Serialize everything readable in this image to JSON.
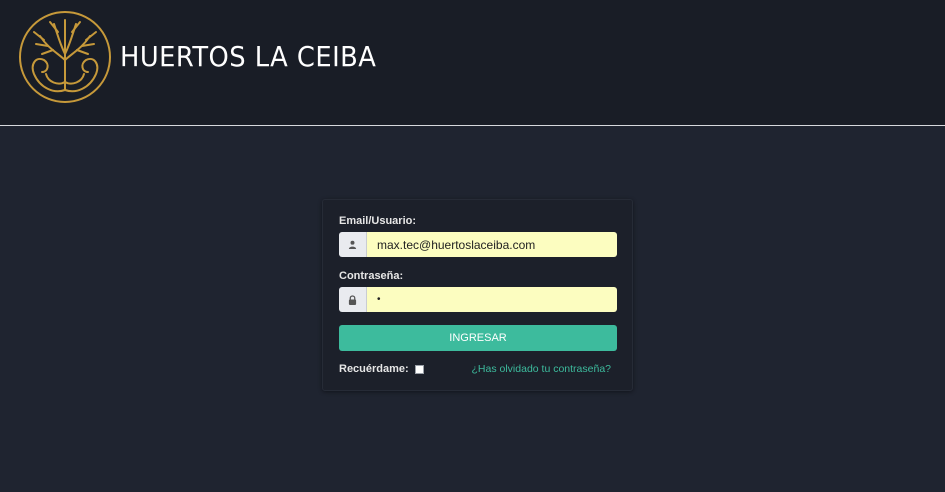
{
  "header": {
    "brand_name": "HUERTOS LA CEIBA",
    "logo_icon": "ceiba-tree-logo-icon",
    "logo_color": "#c6993a"
  },
  "login_form": {
    "email_label": "Email/Usuario:",
    "email_value": "max.tec@huertoslaceiba.com",
    "email_icon": "user-icon",
    "password_label": "Contraseña:",
    "password_value": "•",
    "password_icon": "lock-icon",
    "submit_label": "INGRESAR",
    "remember_label": "Recuérdame:",
    "remember_checked": false,
    "forgot_link": "¿Has olvidado tu contraseña?",
    "accent_color": "#3dbb9d",
    "field_background": "#fcfdc0"
  }
}
